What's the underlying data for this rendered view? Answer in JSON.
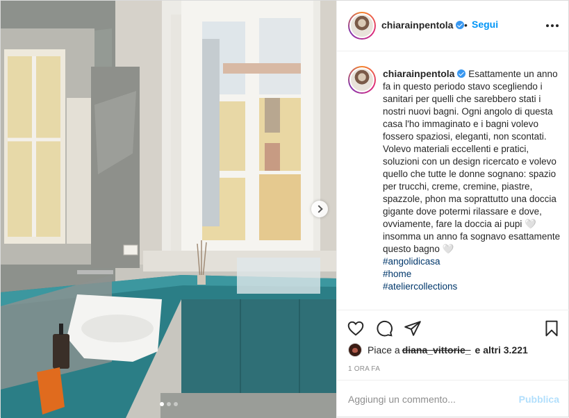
{
  "post": {
    "username": "chiarainpentola",
    "verified": true,
    "follow_label": "Segui",
    "separator": "•",
    "more_icon": "more-options-icon"
  },
  "caption": {
    "text": "Esattamente un anno fa in questo periodo stavo scegliendo i sanitari per quelli che sarebbero stati i nostri nuovi bagni. Ogni angolo di questa casa l'ho immaginato e i bagni volevo fossero spaziosi, eleganti, non scontati. Volevo materiali eccellenti e pratici, soluzioni con un design ricercato e volevo quello che tutte le donne sognano: spazio per trucchi, creme, cremine, piastre, spazzole, phon ma soprattutto una doccia gigante dove potermi rilassare e dove, ovviamente, fare la doccia ai pupi 🤍 insomma un anno fa sognavo esattamente questo bagno 🤍",
    "hashtags": [
      "#angolidicasa",
      "#home",
      "#ateliercollections"
    ]
  },
  "actions": {
    "like_icon": "heart-icon",
    "comment_icon": "comment-icon",
    "share_icon": "share-icon",
    "save_icon": "bookmark-icon"
  },
  "likes": {
    "prefix": "Piace a",
    "first_user": "diana_vittorie_",
    "and_others": "e altri 3.221"
  },
  "timestamp": "1 ora fa",
  "comment_box": {
    "placeholder": "Aggiungi un commento...",
    "publish_label": "Pubblica"
  },
  "carousel": {
    "total_slides": 3,
    "active_slide": 1
  },
  "colors": {
    "link_blue": "#0095f6",
    "hashtag": "#00376b",
    "publish_disabled": "#b2dffc",
    "verified": "#3897f0"
  }
}
